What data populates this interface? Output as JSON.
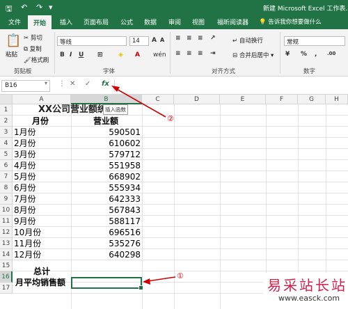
{
  "titlebar": {
    "doc_title": "新建 Microsoft Excel 工作表.xlsx"
  },
  "tabs": [
    "文件",
    "开始",
    "插入",
    "页面布局",
    "公式",
    "数据",
    "审阅",
    "视图",
    "福昕阅读器"
  ],
  "active_tab": "开始",
  "tell_me": "告诉我你想要做什么",
  "ribbon": {
    "clipboard": {
      "paste": "粘贴",
      "cut": "剪切",
      "copy": "复制",
      "format_painter": "格式刷",
      "label": "剪贴板"
    },
    "font": {
      "name": "等线",
      "size": "14",
      "label": "字体"
    },
    "alignment": {
      "wrap": "自动换行",
      "merge": "合并后居中",
      "label": "对齐方式"
    },
    "number": {
      "format": "常规",
      "label": "数字"
    }
  },
  "formula_bar": {
    "name_box": "B16",
    "tooltip": "插入函数"
  },
  "columns": [
    "A",
    "B",
    "C",
    "D",
    "E",
    "F",
    "G",
    "H"
  ],
  "rows": [
    "1",
    "2",
    "3",
    "4",
    "5",
    "6",
    "7",
    "8",
    "9",
    "10",
    "11",
    "12",
    "13",
    "14",
    "15",
    "16",
    "17"
  ],
  "sheet": {
    "title": "XX公司营业额统计",
    "header_month": "月份",
    "header_revenue": "营业额",
    "data": [
      {
        "month": "1月份",
        "revenue": "590501"
      },
      {
        "month": "2月份",
        "revenue": "610602"
      },
      {
        "month": "3月份",
        "revenue": "579712"
      },
      {
        "month": "4月份",
        "revenue": "551958"
      },
      {
        "month": "5月份",
        "revenue": "668902"
      },
      {
        "month": "6月份",
        "revenue": "555934"
      },
      {
        "month": "7月份",
        "revenue": "642333"
      },
      {
        "month": "8月份",
        "revenue": "567843"
      },
      {
        "month": "9月份",
        "revenue": "588117"
      },
      {
        "month": "10月份",
        "revenue": "696516"
      },
      {
        "month": "11月份",
        "revenue": "535276"
      },
      {
        "month": "12月份",
        "revenue": "640298"
      }
    ],
    "total_label": "总计",
    "avg_label": "月平均销售额"
  },
  "callouts": {
    "one": "①",
    "two": "②"
  },
  "watermark": {
    "big": "易采站长站",
    "small": "www.easck.com"
  },
  "colors": {
    "excel_green": "#217346",
    "arrow_red": "#d00000"
  }
}
